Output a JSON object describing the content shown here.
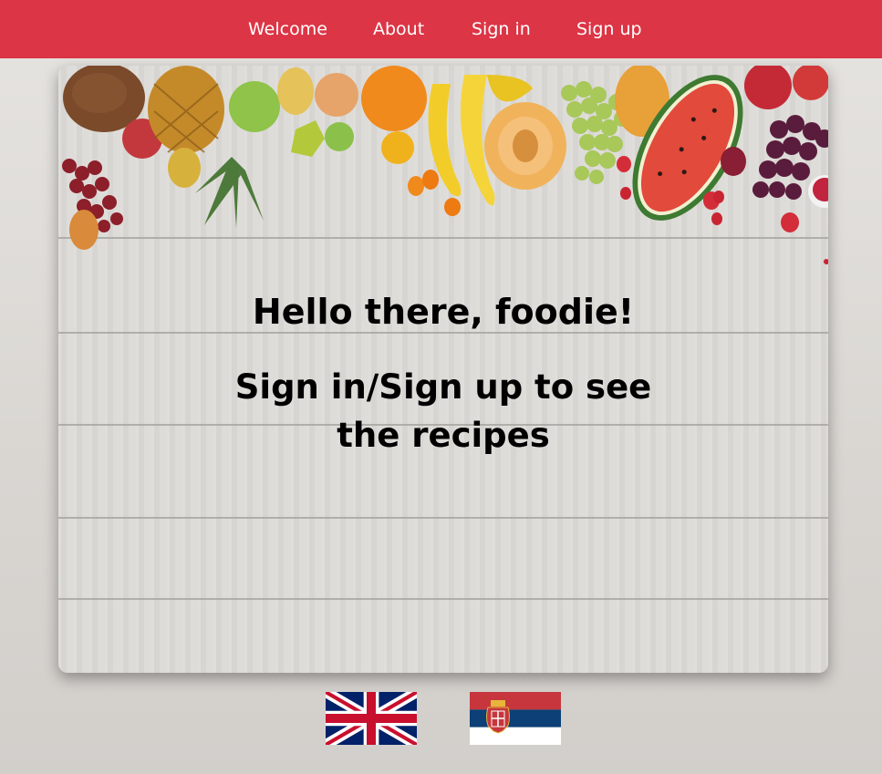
{
  "navbar": {
    "background_color": "#dc3545",
    "items": [
      {
        "label": "Welcome"
      },
      {
        "label": "About"
      },
      {
        "label": "Sign in"
      },
      {
        "label": "Sign up"
      }
    ]
  },
  "hero": {
    "title": "Hello there, foodie!",
    "subtitle": "Sign in/Sign up to see the recipes",
    "background_image": "fruits-on-white-wood-table"
  },
  "languages": [
    {
      "name": "English",
      "icon": "uk-flag-icon"
    },
    {
      "name": "Serbian",
      "icon": "serbia-flag-icon"
    }
  ]
}
